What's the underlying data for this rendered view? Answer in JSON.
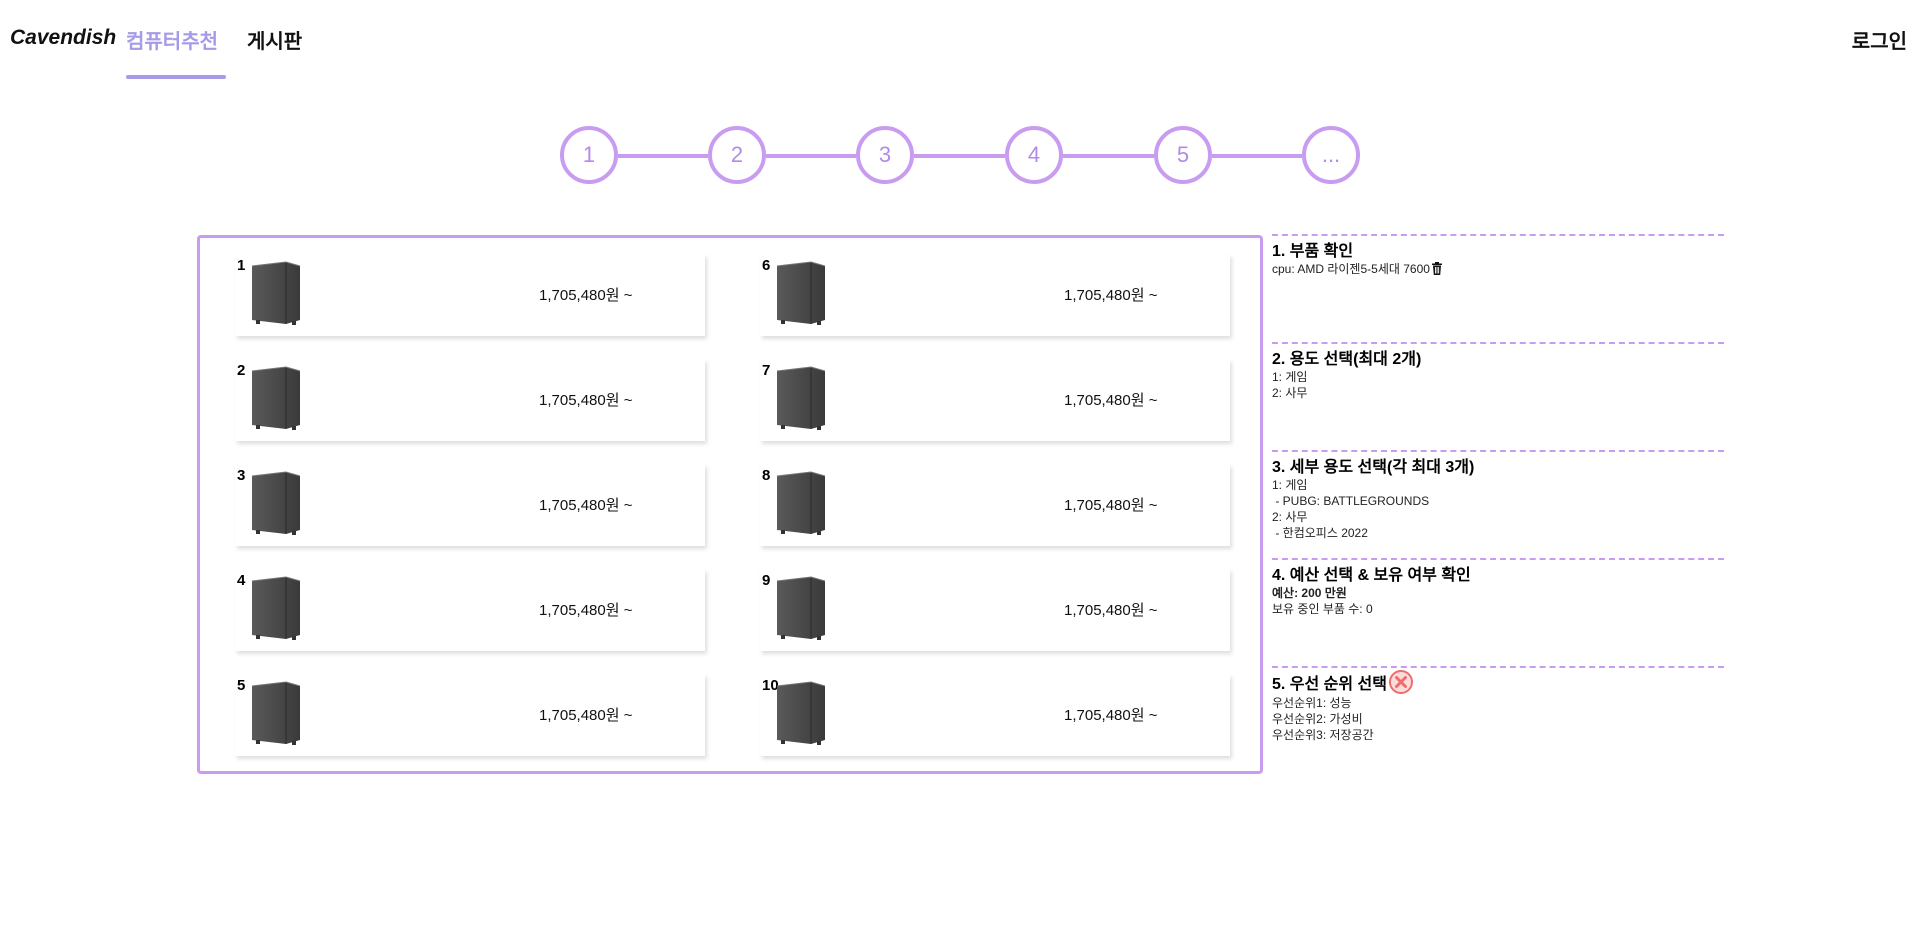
{
  "nav": {
    "brand": "Cavendish",
    "links": [
      {
        "label": "컴퓨터추천",
        "active": true
      },
      {
        "label": "게시판",
        "active": false
      }
    ],
    "login_label": "로그인",
    "accent_color": "#a59be6"
  },
  "stepper": {
    "steps": [
      "1",
      "2",
      "3",
      "4",
      "5",
      "..."
    ],
    "color": "#c89cf0"
  },
  "recommendations": {
    "left": [
      {
        "rank": "1",
        "price": "1,705,480원 ~",
        "icon": "pc-case-icon"
      },
      {
        "rank": "2",
        "price": "1,705,480원 ~",
        "icon": "pc-case-icon"
      },
      {
        "rank": "3",
        "price": "1,705,480원 ~",
        "icon": "pc-case-icon"
      },
      {
        "rank": "4",
        "price": "1,705,480원 ~",
        "icon": "pc-case-icon"
      },
      {
        "rank": "5",
        "price": "1,705,480원 ~",
        "icon": "pc-case-icon"
      }
    ],
    "right": [
      {
        "rank": "6",
        "price": "1,705,480원 ~",
        "icon": "pc-case-icon"
      },
      {
        "rank": "7",
        "price": "1,705,480원 ~",
        "icon": "pc-case-icon"
      },
      {
        "rank": "8",
        "price": "1,705,480원 ~",
        "icon": "pc-case-icon"
      },
      {
        "rank": "9",
        "price": "1,705,480원 ~",
        "icon": "pc-case-icon"
      },
      {
        "rank": "10",
        "price": "1,705,480원 ~",
        "icon": "pc-case-icon"
      }
    ]
  },
  "summary": {
    "parts": {
      "title": "1. 부품 확인",
      "items": [
        "cpu: AMD 라이젠5-5세대 7600"
      ],
      "delete_icon": "trash-icon"
    },
    "usage": {
      "title": "2. 용도 선택(최대 2개)",
      "items": [
        "1: 게임",
        "2: 사무"
      ]
    },
    "detail_usage": {
      "title": "3. 세부 용도 선택(각 최대 3개)",
      "items": [
        "1: 게임",
        " - PUBG: BATTLEGROUNDS",
        "2: 사무",
        " - 한컴오피스 2022"
      ]
    },
    "budget": {
      "title": "4. 예산 선택 & 보유 여부 확인",
      "budget_line": "예산: 200 만원",
      "owned_line": "보유 중인 부품 수: 0"
    },
    "priority": {
      "title": "5. 우선 순위 선택",
      "clear_icon": "close-circle-icon",
      "items": [
        "우선순위1: 성능",
        "우선순위2: 가성비",
        "우선순위3: 저장공간"
      ],
      "icon_color": "#ee6e6e"
    }
  }
}
